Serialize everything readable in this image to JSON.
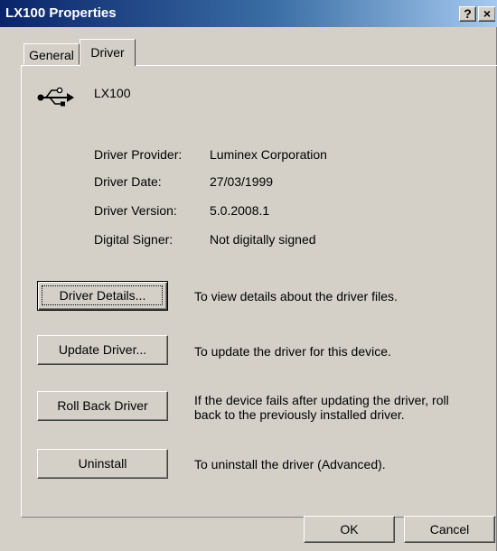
{
  "window": {
    "title": "LX100 Properties",
    "help_glyph": "?",
    "close_glyph": "×"
  },
  "tabs": [
    {
      "label": "General",
      "selected": false
    },
    {
      "label": "Driver",
      "selected": true
    }
  ],
  "device": {
    "name": "LX100",
    "icon": "usb-icon"
  },
  "info": [
    {
      "label": "Driver Provider:",
      "value": "Luminex Corporation"
    },
    {
      "label": "Driver Date:",
      "value": "27/03/1999"
    },
    {
      "label": "Driver Version:",
      "value": "5.0.2008.1"
    },
    {
      "label": "Digital Signer:",
      "value": "Not digitally signed"
    }
  ],
  "actions": [
    {
      "label": "Driver Details...",
      "description": "To view details about the driver files."
    },
    {
      "label": "Update Driver...",
      "description": "To update the driver for this device."
    },
    {
      "label": "Roll Back Driver",
      "description": "If the device fails after updating the driver, roll back to the previously installed driver."
    },
    {
      "label": "Uninstall",
      "description": "To uninstall the driver (Advanced)."
    }
  ],
  "footer": {
    "ok_label": "OK",
    "cancel_label": "Cancel"
  }
}
